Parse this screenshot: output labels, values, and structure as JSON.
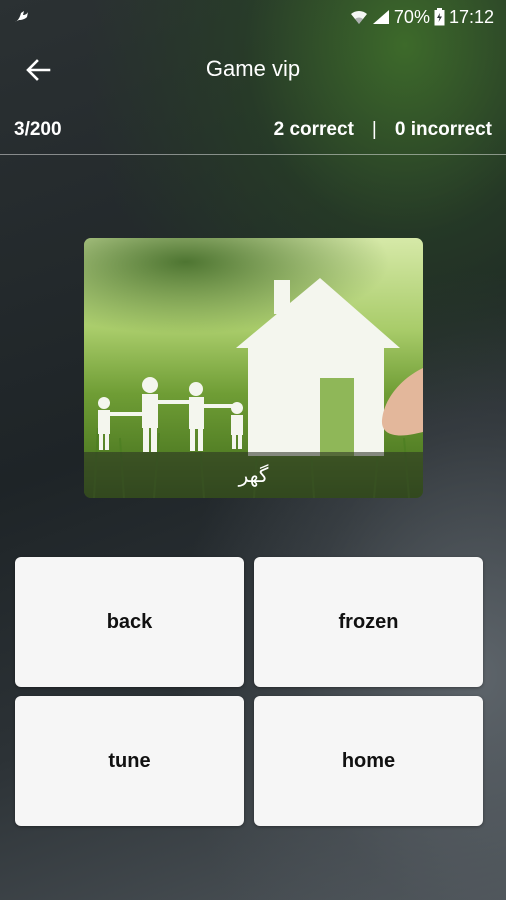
{
  "status_bar": {
    "battery": "70%",
    "time": "17:12"
  },
  "app_bar": {
    "title": "Game vip"
  },
  "score": {
    "progress": "3/200",
    "correct": "2 correct",
    "separator": "|",
    "incorrect": "0 incorrect"
  },
  "question": {
    "word": "گھر"
  },
  "answers": [
    {
      "label": "back"
    },
    {
      "label": "frozen"
    },
    {
      "label": "tune"
    },
    {
      "label": "home"
    }
  ],
  "icons": {
    "status_left": "whatsapp-icon",
    "wifi": "wifi-icon",
    "signal": "signal-icon",
    "battery": "battery-icon",
    "back": "arrow-left-icon"
  }
}
